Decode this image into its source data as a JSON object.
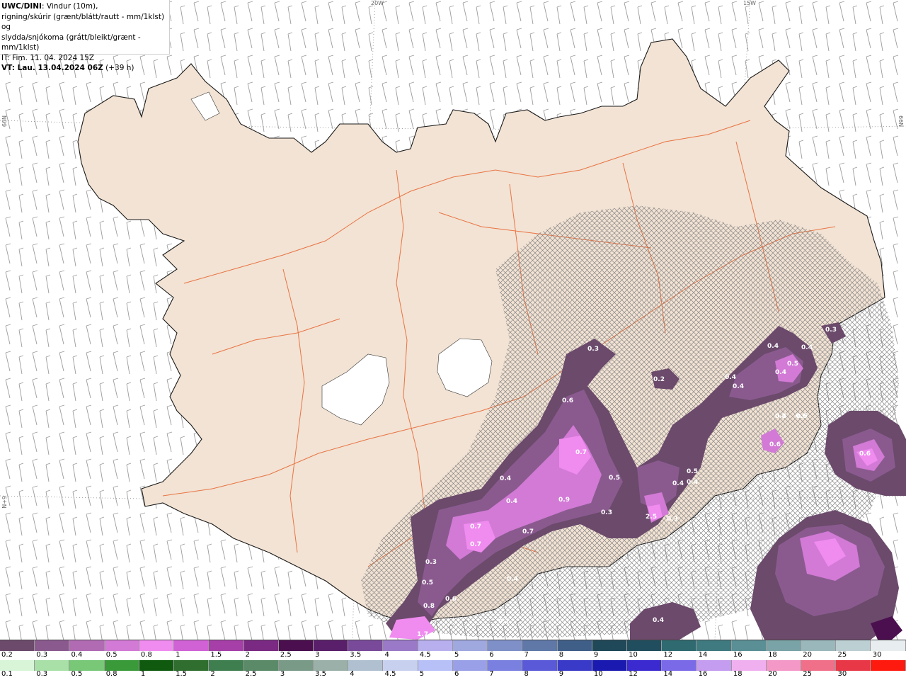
{
  "title": {
    "model": "UWC/DINI",
    "line1_rest": ": Vindur (10m),",
    "line2": "rigning/skúrir (grænt/blátt/rautt - mm/1klst) og",
    "line3": "slydda/snjókoma (grátt/bleikt/grænt - mm/1klst)",
    "issue_time": "IT: Fim. 11. 04. 2024 15Z",
    "valid_prefix": "VT: Lau. 13.04.2024 06Z",
    "valid_suffix": " (+39 h)"
  },
  "coordinates": {
    "lon_20w": "20W",
    "lon_15w": "15W",
    "lat_left": "66N",
    "lat_right": "66N",
    "lat_left_lower": "N+9"
  },
  "map_labels": [
    "0.3",
    "0.4",
    "0.4",
    "0.3",
    "0.5",
    "0.4",
    "0.4",
    "0.2",
    "0.6",
    "0.4",
    "0.5",
    "0.6",
    "0.6",
    "0.7",
    "0.4",
    "0.5",
    "0.5",
    "0.4",
    "0.4",
    "0.4",
    "0.9",
    "0.3",
    "2.5",
    "0.3",
    "0.4",
    "0.7",
    "0.7",
    "0.7",
    "0.3",
    "0.5",
    "0.8",
    "0.6",
    "0.4",
    "0.7",
    "1.7",
    "0.4",
    "0.5",
    "0.6"
  ],
  "legend": {
    "top_labels": [
      "0.2",
      "0.3",
      "0.4",
      "0.5",
      "0.8",
      "1",
      "1.5",
      "2",
      "2.5",
      "3",
      "3.5",
      "4",
      "4.5",
      "5",
      "6",
      "7",
      "8",
      "9",
      "10",
      "12",
      "14",
      "16",
      "18",
      "20",
      "25",
      "30"
    ],
    "bottom_labels": [
      "0.1",
      "0.3",
      "0.5",
      "0.8",
      "1",
      "1.5",
      "2",
      "2.5",
      "3",
      "3.5",
      "4",
      "4.5",
      "5",
      "6",
      "7",
      "8",
      "9",
      "10",
      "12",
      "14",
      "16",
      "18",
      "20",
      "25",
      "30"
    ],
    "top_colors": [
      "#6b4a6b",
      "#8a5a8f",
      "#b06bb3",
      "#d27ad6",
      "#f08bf0",
      "#d062d6",
      "#a63fa8",
      "#7a2a82",
      "#4b0f4f",
      "#5a1f6a",
      "#7a4a9a",
      "#9a7ac8",
      "#b8b0ee",
      "#a0a8e0",
      "#7f90c8",
      "#5f78a8",
      "#3f5f88",
      "#1f4858",
      "#214e5e",
      "#2e6a70",
      "#3f7a80",
      "#5a8f96",
      "#7aa3a8",
      "#9ab8bc",
      "#bccfd2",
      "#e8eef0"
    ],
    "bottom_colors": [
      "#d8f5d8",
      "#a8e0a8",
      "#78c878",
      "#3a9a3a",
      "#0f5a0f",
      "#2f6e2f",
      "#3f7f4f",
      "#5a8a68",
      "#7a9a88",
      "#9ab0a8",
      "#b0c0d0",
      "#c8d0f0",
      "#b8c0f8",
      "#9aa0e8",
      "#7a80e0",
      "#5a5ad8",
      "#3a3ac8",
      "#1a1ab0",
      "#3a2ad0",
      "#7a6ae8",
      "#c49cf0",
      "#f0b0f0",
      "#f498c8",
      "#f0708a",
      "#e83848",
      "#ff1a10"
    ]
  }
}
